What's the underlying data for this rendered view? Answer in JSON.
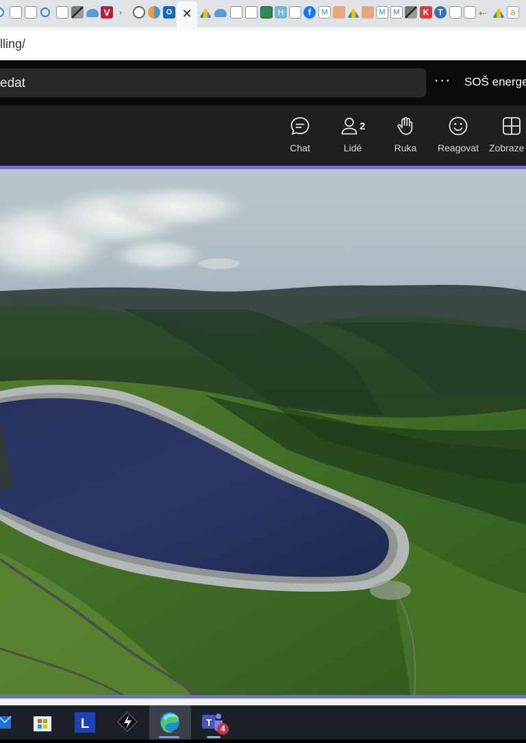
{
  "browser": {
    "tab_icons": [
      "search-icon",
      "page-icon",
      "page-icon",
      "search-icon",
      "page-icon",
      "edge-app-icon",
      "onedrive-icon",
      "v-logo-icon",
      "arrow-icon",
      "wordpress-icon",
      "puzzle-icon",
      "outlook-icon",
      "drive-icon",
      "onedrive-icon",
      "page-icon",
      "page-icon",
      "sheet-icon",
      "h-icon",
      "page-icon",
      "facebook-icon",
      "m-icon",
      "people-icon",
      "drive-icon",
      "people-icon",
      "m-icon",
      "m-icon",
      "edge-app-icon",
      "k-icon",
      "t-icon",
      "page-icon",
      "page-icon",
      "arrow-icon",
      "drive-icon",
      "amazon-icon"
    ],
    "address_url": "lling/"
  },
  "teams_header": {
    "search_placeholder": "edat",
    "more_label": "···",
    "org_name": "SOŠ energet"
  },
  "meeting_bar": {
    "controls": [
      {
        "label": "Chat",
        "icon": "chat-icon"
      },
      {
        "label": "Lidé",
        "icon": "people-icon",
        "count": "2"
      },
      {
        "label": "Ruka",
        "icon": "raise-hand-icon"
      },
      {
        "label": "Reagovat",
        "icon": "emoji-icon"
      },
      {
        "label": "Zobraze",
        "icon": "view-grid-icon"
      }
    ]
  },
  "stage": {
    "content": "shared-video-aerial-reservoir"
  },
  "taskbar": {
    "items": [
      {
        "name": "mail-icon"
      },
      {
        "name": "store-icon"
      },
      {
        "name": "l-app-icon",
        "letter": "L"
      },
      {
        "name": "app-icon"
      },
      {
        "name": "edge-icon",
        "active": true
      },
      {
        "name": "teams-icon",
        "badge": "4"
      }
    ]
  },
  "colors": {
    "accent": "#6f70d0",
    "meeting_bar_bg": "#1f1f1f",
    "header_bg": "#0b0b0b",
    "taskbar_bg": "#1c2029",
    "teams_badge": "#c4314b"
  }
}
